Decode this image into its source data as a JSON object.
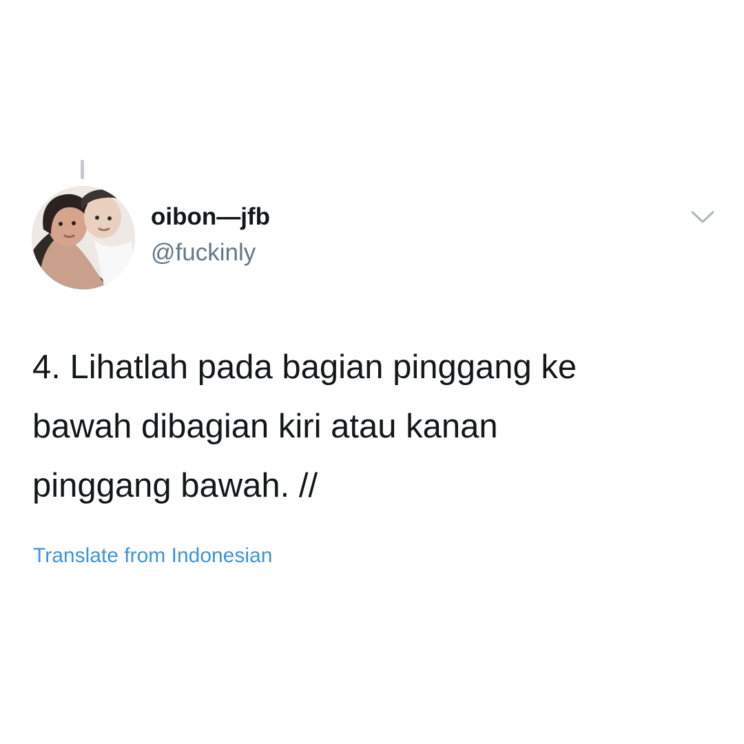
{
  "tweet": {
    "display_name": "oibon—jfb",
    "handle": "@fuckinly",
    "text_lines": [
      "4. Lihatlah pada bagian pinggang ke",
      "bawah dibagian kiri atau kanan",
      "pinggang bawah. //"
    ],
    "translate_label": "Translate from Indonesian",
    "avatar_icon": "profile-avatar",
    "menu_icon": "chevron-down-icon"
  },
  "colors": {
    "text": "#14171a",
    "muted": "#657786",
    "link": "#3b94d9",
    "thread_line": "#c4c9ce",
    "background": "#ffffff"
  }
}
